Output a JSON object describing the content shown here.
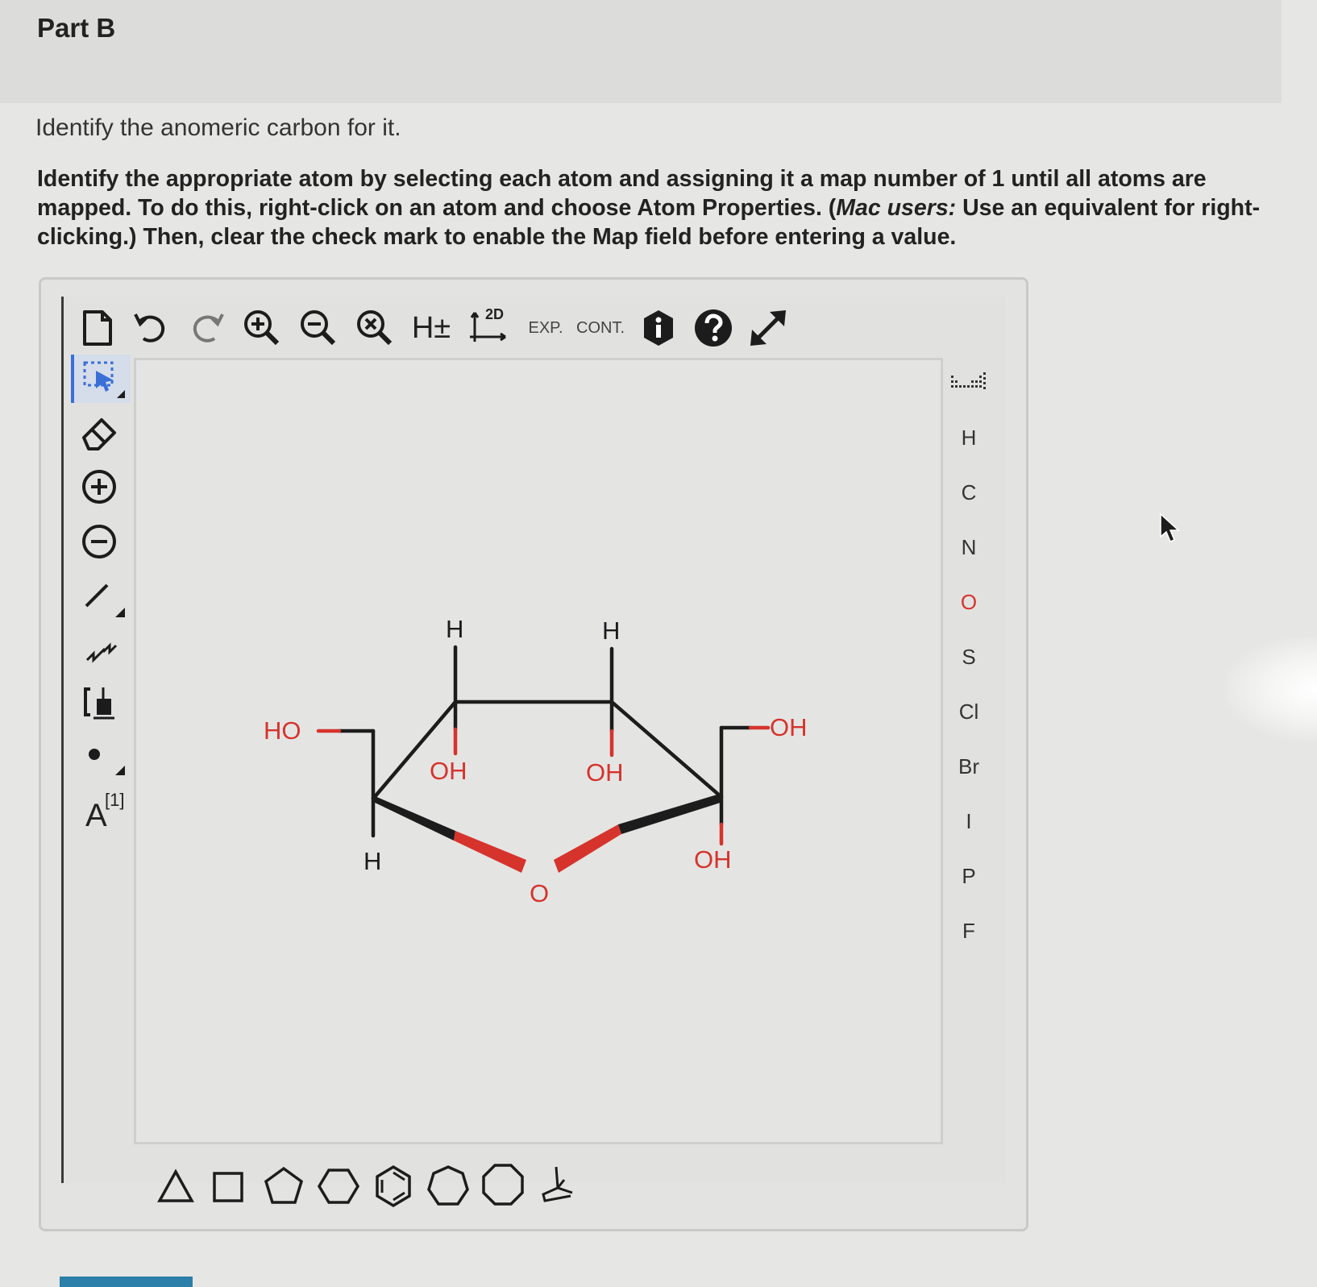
{
  "part": {
    "title": "Part B"
  },
  "question": {
    "prompt": "Identify the anomeric carbon for it.",
    "instr_a": "Identify the appropriate atom by selecting each atom and assigning it a map number of 1 until all atoms are mapped. To do this, right-click on an atom and choose Atom Properties. (",
    "instr_italic": "Mac users:",
    "instr_b": " Use an equivalent for right-clicking.) Then, clear the check mark to enable the Map field before entering a value."
  },
  "toolbar": {
    "h_toggle": "H±",
    "clean2d": "2D",
    "expand": "EXP.",
    "contract": "CONT."
  },
  "left_tools": {
    "map_label": "A",
    "map_index": "[1]"
  },
  "elements": [
    "H",
    "C",
    "N",
    "O",
    "S",
    "Cl",
    "Br",
    "I",
    "P",
    "F"
  ],
  "molecule": {
    "labels": {
      "ho_left": "HO",
      "h_c4_top": "H",
      "oh_c4": "OH",
      "h_c3_top": "H",
      "oh_c3": "OH",
      "oh_right": "OH",
      "h_c5": "H",
      "oh_c2": "OH",
      "ring_o": "O"
    }
  },
  "colors": {
    "bond": "#1c1c1c",
    "oxygen": "#d6332d",
    "accent": "#3a6fd8",
    "progress": "#2b7fa8"
  }
}
